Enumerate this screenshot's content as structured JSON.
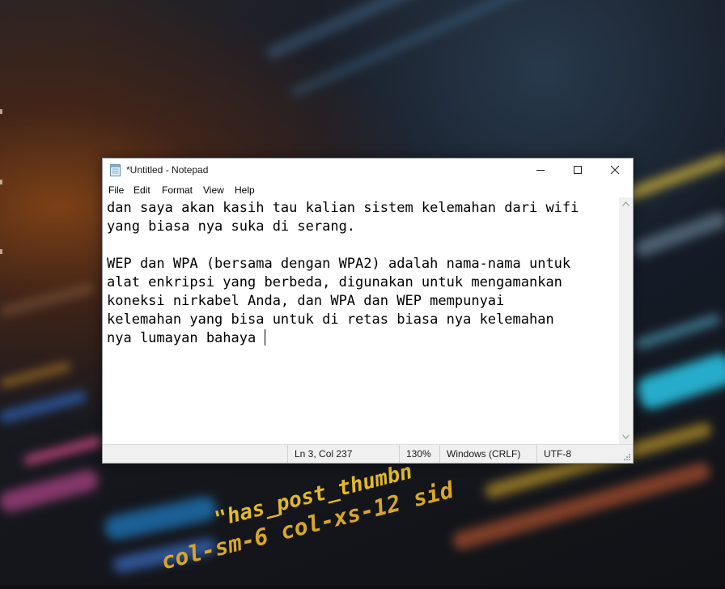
{
  "window": {
    "title": "*Untitled - Notepad",
    "app_icon": "notepad-icon"
  },
  "title_buttons": {
    "minimize_icon": "minimize-icon",
    "maximize_icon": "maximize-icon",
    "close_icon": "close-icon"
  },
  "menu": [
    "File",
    "Edit",
    "Format",
    "View",
    "Help"
  ],
  "editor": {
    "lines": [
      "dan saya akan kasih tau kalian sistem kelemahan dari wifi",
      "yang biasa nya suka di serang.",
      "",
      "WEP dan WPA (bersama dengan WPA2) adalah nama-nama untuk",
      "alat enkripsi yang berbeda, digunakan untuk mengamankan",
      "koneksi nirkabel Anda, dan WPA dan WEP mempunyai",
      "kelemahan yang bisa untuk di retas biasa nya kelemahan",
      "nya lumayan bahaya "
    ]
  },
  "statusbar": {
    "position": "Ln 3, Col 237",
    "zoom": "130%",
    "line_ending": "Windows (CRLF)",
    "encoding": "UTF-8"
  },
  "wallpaper": {
    "code_text_1": "\"has_post_thumbn",
    "code_text_2": "col-sm-6 col-xs-12 sid",
    "code_text_3": "col-sm-6",
    "colors": {
      "yellow": "#e3b928",
      "cyan": "#29c6e8",
      "blue": "#2d5fb0",
      "pink": "#e0508c",
      "orange": "#c0601c"
    }
  }
}
